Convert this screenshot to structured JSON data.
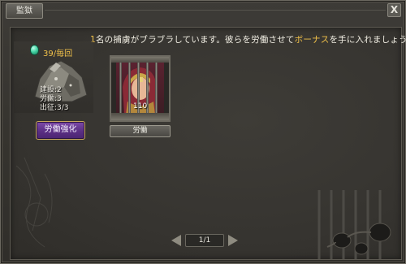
{
  "window": {
    "tab_label": "監獄",
    "close_glyph": "X"
  },
  "message": {
    "count": "1",
    "part1": "名の捕虜がブラブラしています。彼らを労働させて",
    "bonus": "ボーナス",
    "part2": "を手に入れましょう！"
  },
  "resource": {
    "icon": "gem-icon",
    "counter": "39/毎回",
    "stats": [
      "建設:2",
      "労働:3",
      "出征:3/3"
    ]
  },
  "buttons": {
    "strengthen_label": "労働強化",
    "labor_label": "労働"
  },
  "prisoner": {
    "level": "110"
  },
  "pagination": {
    "page": "1/1"
  },
  "colors": {
    "highlight": "#f2c24a",
    "button_purple": "#5b2f84"
  }
}
